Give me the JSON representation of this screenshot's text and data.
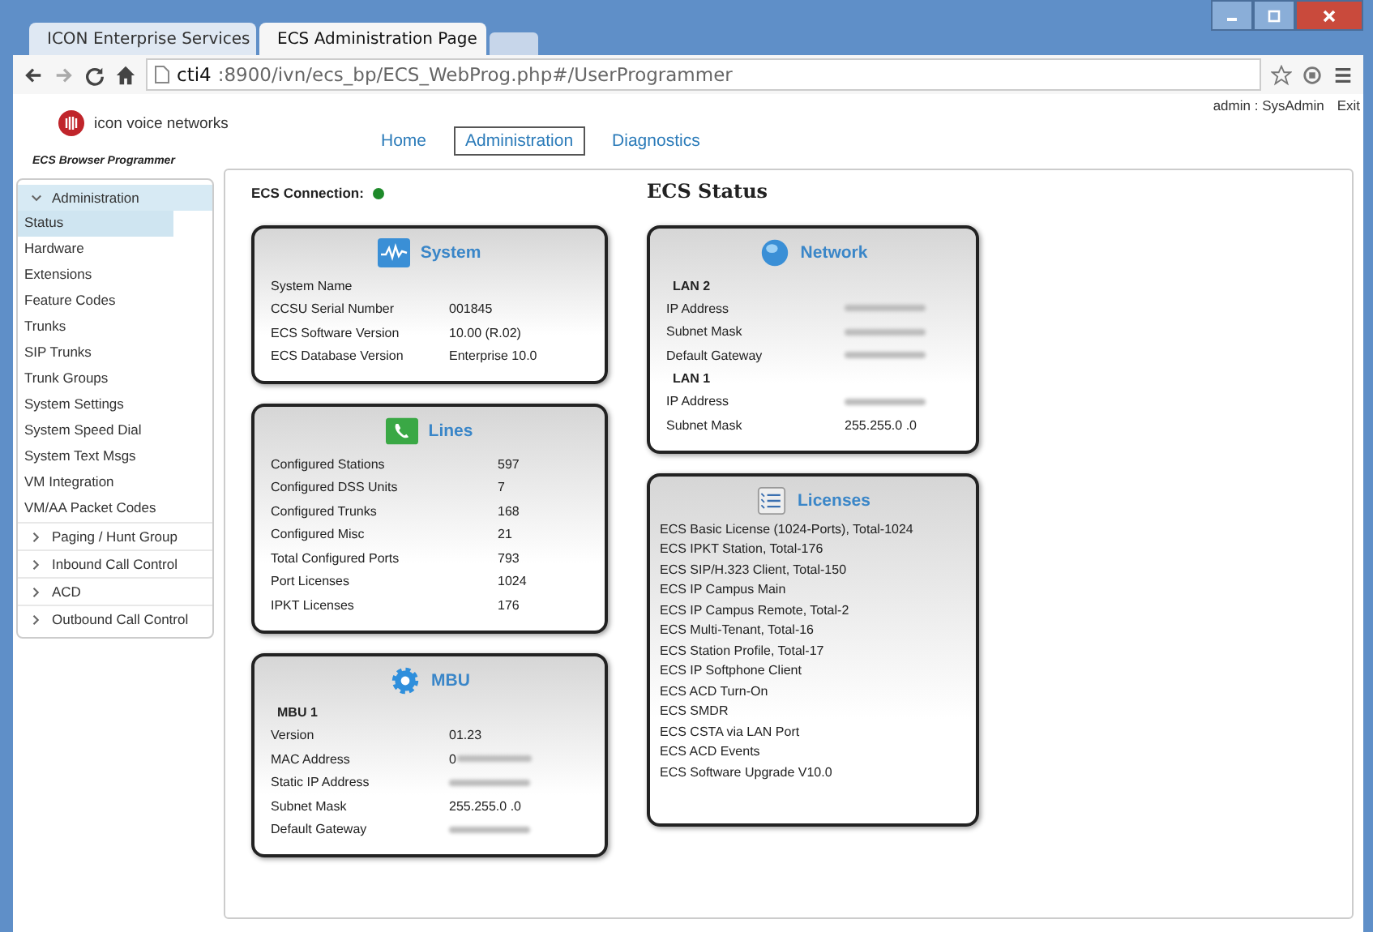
{
  "browser": {
    "tabs": [
      {
        "label": "ICON Enterprise Services",
        "selected": false
      },
      {
        "label": "ECS Administration Page",
        "selected": true
      }
    ],
    "address_host": "cti4",
    "address_rest": ":8900/ivn/ecs_bp/ECS_WebProg.php#/UserProgrammer"
  },
  "header": {
    "logo_text": "icon voice networks",
    "subtitle": "ECS Browser Programmer",
    "user": "admin : SysAdmin",
    "exit": "Exit",
    "nav": [
      {
        "label": "Home",
        "selected": false
      },
      {
        "label": "Administration",
        "selected": true
      },
      {
        "label": "Diagnostics",
        "selected": false
      }
    ]
  },
  "sidebar": [
    {
      "label": "Administration",
      "expanded": true,
      "children": [
        {
          "label": "Status",
          "selected": true
        },
        {
          "label": "Hardware",
          "selected": false
        },
        {
          "label": "Extensions",
          "selected": false
        },
        {
          "label": "Feature Codes",
          "selected": false
        },
        {
          "label": "Trunks",
          "selected": false
        },
        {
          "label": "SIP Trunks",
          "selected": false
        },
        {
          "label": "Trunk Groups",
          "selected": false
        },
        {
          "label": "System Settings",
          "selected": false
        },
        {
          "label": "System Speed Dial",
          "selected": false
        },
        {
          "label": "System Text Msgs",
          "selected": false
        },
        {
          "label": "VM Integration",
          "selected": false
        },
        {
          "label": "VM/AA Packet Codes",
          "selected": false
        }
      ]
    },
    {
      "label": "Paging / Hunt Group",
      "expanded": false
    },
    {
      "label": "Inbound Call Control",
      "expanded": false
    },
    {
      "label": "ACD",
      "expanded": false
    },
    {
      "label": "Outbound Call Control",
      "expanded": false
    }
  ],
  "connection": {
    "label": "ECS Connection:",
    "connected": true
  },
  "title": "ECS Status",
  "system": {
    "title": "System",
    "rows": [
      {
        "label": "System Name"
      },
      {
        "label": "CCSU Serial Number",
        "value": "001845"
      },
      {
        "label": "ECS Software Version",
        "value": "10.00 (R.02)"
      },
      {
        "label": "ECS Database Version",
        "value": "Enterprise 10.0"
      }
    ]
  },
  "lines": {
    "title": "Lines",
    "rows": [
      {
        "label": "Configured Stations",
        "value": "597"
      },
      {
        "label": "Configured DSS Units",
        "value": "7"
      },
      {
        "label": "Configured Trunks",
        "value": "168"
      },
      {
        "label": "Configured Misc",
        "value": "21"
      },
      {
        "label": "Total Configured Ports",
        "value": "793"
      },
      {
        "label": "Port Licenses",
        "value": "1024"
      },
      {
        "label": "IPKT Licenses",
        "value": "176"
      }
    ]
  },
  "mbu": {
    "title": "MBU",
    "subtitle": "MBU 1",
    "rows": [
      {
        "label": "Version",
        "value": "01.23"
      },
      {
        "label": "MAC Address",
        "value": "0",
        "blurred": true
      },
      {
        "label": "Static IP Address",
        "blurred": true
      },
      {
        "label": "Subnet Mask",
        "value": "255.255.0 .0"
      },
      {
        "label": "Default Gateway",
        "blurred": true
      }
    ]
  },
  "network": {
    "title": "Network",
    "sections": [
      {
        "title": "LAN 2",
        "rows": [
          {
            "label": "IP Address",
            "blurred": true
          },
          {
            "label": "Subnet Mask",
            "blurred": true
          },
          {
            "label": "Default Gateway",
            "blurred": true
          }
        ]
      },
      {
        "title": "LAN 1",
        "rows": [
          {
            "label": "IP Address",
            "blurred": true
          },
          {
            "label": "Subnet Mask",
            "value": "255.255.0 .0"
          }
        ]
      }
    ]
  },
  "licenses": {
    "title": "Licenses",
    "items": [
      "ECS Basic License (1024-Ports), Total-1024",
      "ECS IPKT Station, Total-176",
      "ECS SIP/H.323 Client, Total-150",
      "ECS IP Campus Main",
      "ECS IP Campus Remote, Total-2",
      "ECS Multi-Tenant, Total-16",
      "ECS Station Profile, Total-17",
      "ECS IP Softphone Client",
      "ECS ACD Turn-On",
      "ECS SMDR",
      "ECS CSTA via LAN Port",
      "ECS ACD Events",
      "ECS Software Upgrade V10.0"
    ]
  }
}
